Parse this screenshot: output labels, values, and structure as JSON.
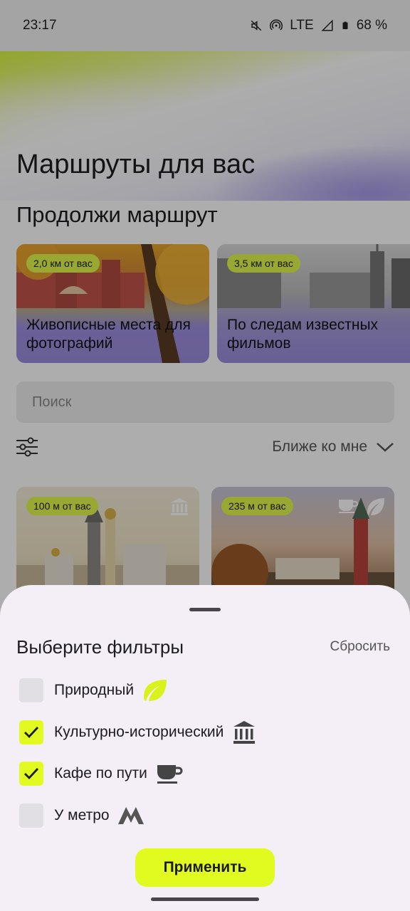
{
  "status_bar": {
    "time": "23:17",
    "network": "LTE",
    "battery": "68 %"
  },
  "page": {
    "title": "Маршруты для вас",
    "continue_heading": "Продолжи маршрут"
  },
  "route_cards": [
    {
      "distance": "2,0 км от вас",
      "title": "Живописные места для фотографий"
    },
    {
      "distance": "3,5 км от вас",
      "title": "По следам известных фильмов"
    }
  ],
  "search": {
    "placeholder": "Поиск"
  },
  "sort": {
    "label": "Ближе ко мне"
  },
  "place_cards": [
    {
      "distance": "100 м от вас"
    },
    {
      "distance": "235 м от вас"
    }
  ],
  "filters_sheet": {
    "title": "Выберите фильтры",
    "reset_label": "Сбросить",
    "options": [
      {
        "label": "Природный",
        "checked": false,
        "icon": "leaf-icon"
      },
      {
        "label": "Культурно-исторический",
        "checked": true,
        "icon": "museum-icon"
      },
      {
        "label": "Кафе по пути",
        "checked": true,
        "icon": "coffee-cup-icon"
      },
      {
        "label": "У метро",
        "checked": false,
        "icon": "metro-icon"
      }
    ],
    "apply_label": "Применить"
  },
  "colors": {
    "accent": "#e1fb21",
    "route_card_overlay": "#9a8ddc"
  }
}
